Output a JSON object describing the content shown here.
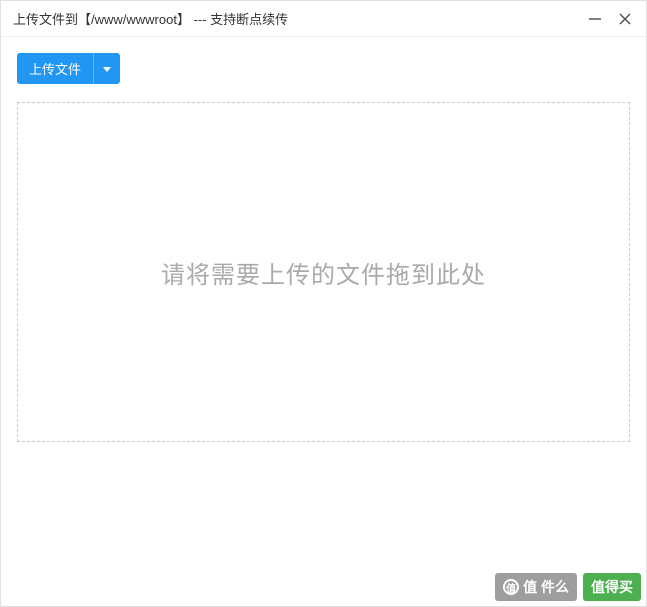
{
  "titlebar": {
    "title": "上传文件到【/www/wwwroot】 --- 支持断点续传"
  },
  "toolbar": {
    "upload_label": "上传文件"
  },
  "dropzone": {
    "hint": "请将需要上传的文件拖到此处"
  },
  "footer": {
    "badge1_text": "值 件么",
    "badge2_text": "值得买"
  }
}
